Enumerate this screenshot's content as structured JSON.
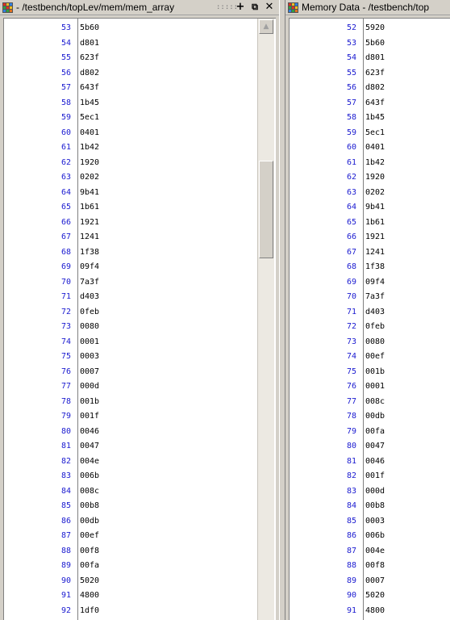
{
  "left_pane": {
    "title": "- /testbench/topLev/mem/mem_array",
    "grip": ":::::",
    "buttons": {
      "dock": "+",
      "undock": "⧉",
      "close": "✕"
    },
    "rows": [
      {
        "addr": "53",
        "val": "5b60"
      },
      {
        "addr": "54",
        "val": "d801"
      },
      {
        "addr": "55",
        "val": "623f"
      },
      {
        "addr": "56",
        "val": "d802"
      },
      {
        "addr": "57",
        "val": "643f"
      },
      {
        "addr": "58",
        "val": "1b45"
      },
      {
        "addr": "59",
        "val": "5ec1"
      },
      {
        "addr": "60",
        "val": "0401"
      },
      {
        "addr": "61",
        "val": "1b42"
      },
      {
        "addr": "62",
        "val": "1920"
      },
      {
        "addr": "63",
        "val": "0202"
      },
      {
        "addr": "64",
        "val": "9b41"
      },
      {
        "addr": "65",
        "val": "1b61"
      },
      {
        "addr": "66",
        "val": "1921"
      },
      {
        "addr": "67",
        "val": "1241"
      },
      {
        "addr": "68",
        "val": "1f38"
      },
      {
        "addr": "69",
        "val": "09f4"
      },
      {
        "addr": "70",
        "val": "7a3f"
      },
      {
        "addr": "71",
        "val": "d403"
      },
      {
        "addr": "72",
        "val": "0feb"
      },
      {
        "addr": "73",
        "val": "0080"
      },
      {
        "addr": "74",
        "val": "0001"
      },
      {
        "addr": "75",
        "val": "0003"
      },
      {
        "addr": "76",
        "val": "0007"
      },
      {
        "addr": "77",
        "val": "000d"
      },
      {
        "addr": "78",
        "val": "001b"
      },
      {
        "addr": "79",
        "val": "001f"
      },
      {
        "addr": "80",
        "val": "0046"
      },
      {
        "addr": "81",
        "val": "0047"
      },
      {
        "addr": "82",
        "val": "004e"
      },
      {
        "addr": "83",
        "val": "006b"
      },
      {
        "addr": "84",
        "val": "008c"
      },
      {
        "addr": "85",
        "val": "00b8"
      },
      {
        "addr": "86",
        "val": "00db"
      },
      {
        "addr": "87",
        "val": "00ef"
      },
      {
        "addr": "88",
        "val": "00f8"
      },
      {
        "addr": "89",
        "val": "00fa"
      },
      {
        "addr": "90",
        "val": "5020"
      },
      {
        "addr": "91",
        "val": "4800"
      },
      {
        "addr": "92",
        "val": "1df0"
      }
    ]
  },
  "right_pane": {
    "title": "Memory Data - /testbench/top",
    "rows": [
      {
        "addr": "52",
        "val": "5920"
      },
      {
        "addr": "53",
        "val": "5b60"
      },
      {
        "addr": "54",
        "val": "d801"
      },
      {
        "addr": "55",
        "val": "623f"
      },
      {
        "addr": "56",
        "val": "d802"
      },
      {
        "addr": "57",
        "val": "643f"
      },
      {
        "addr": "58",
        "val": "1b45"
      },
      {
        "addr": "59",
        "val": "5ec1"
      },
      {
        "addr": "60",
        "val": "0401"
      },
      {
        "addr": "61",
        "val": "1b42"
      },
      {
        "addr": "62",
        "val": "1920"
      },
      {
        "addr": "63",
        "val": "0202"
      },
      {
        "addr": "64",
        "val": "9b41"
      },
      {
        "addr": "65",
        "val": "1b61"
      },
      {
        "addr": "66",
        "val": "1921"
      },
      {
        "addr": "67",
        "val": "1241"
      },
      {
        "addr": "68",
        "val": "1f38"
      },
      {
        "addr": "69",
        "val": "09f4"
      },
      {
        "addr": "70",
        "val": "7a3f"
      },
      {
        "addr": "71",
        "val": "d403"
      },
      {
        "addr": "72",
        "val": "0feb"
      },
      {
        "addr": "73",
        "val": "0080"
      },
      {
        "addr": "74",
        "val": "00ef"
      },
      {
        "addr": "75",
        "val": "001b"
      },
      {
        "addr": "76",
        "val": "0001"
      },
      {
        "addr": "77",
        "val": "008c"
      },
      {
        "addr": "78",
        "val": "00db"
      },
      {
        "addr": "79",
        "val": "00fa"
      },
      {
        "addr": "80",
        "val": "0047"
      },
      {
        "addr": "81",
        "val": "0046"
      },
      {
        "addr": "82",
        "val": "001f"
      },
      {
        "addr": "83",
        "val": "000d"
      },
      {
        "addr": "84",
        "val": "00b8"
      },
      {
        "addr": "85",
        "val": "0003"
      },
      {
        "addr": "86",
        "val": "006b"
      },
      {
        "addr": "87",
        "val": "004e"
      },
      {
        "addr": "88",
        "val": "00f8"
      },
      {
        "addr": "89",
        "val": "0007"
      },
      {
        "addr": "90",
        "val": "5020"
      },
      {
        "addr": "91",
        "val": "4800"
      }
    ]
  },
  "colors": {
    "address": "#1a1ad0",
    "value": "#000000",
    "chrome": "#d4d0c8"
  },
  "icons": {
    "app": "grid-app-icon",
    "scroll_up": "scroll-up-arrow-icon"
  }
}
